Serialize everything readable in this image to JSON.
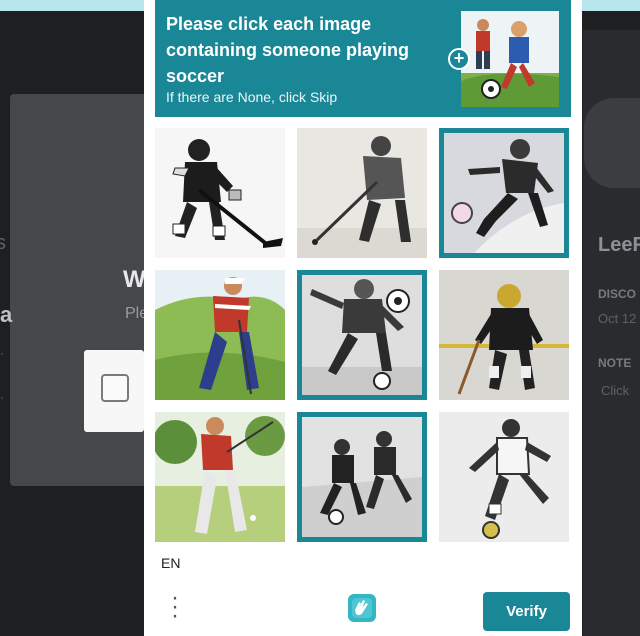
{
  "background": {
    "heading": "W",
    "subtext": "Ple",
    "left_letter": "a",
    "left_fragment": "s",
    "bottom_text": "...",
    "right_title": "LeeF",
    "right_label1": "DISCO",
    "right_value1": "Oct 12",
    "right_label2": "NOTE",
    "right_value2": "Click"
  },
  "captcha": {
    "prompt": "Please click each image containing someone playing soccer",
    "hint": "If there are None, click Skip",
    "example_icon": "soccer-player-example-image",
    "tiles": [
      {
        "subject": "hockey-player",
        "selected": false
      },
      {
        "subject": "hockey-player-stick",
        "selected": false
      },
      {
        "subject": "soccer-player-kicking",
        "selected": true
      },
      {
        "subject": "golfer",
        "selected": false
      },
      {
        "subject": "soccer-player-ball",
        "selected": true
      },
      {
        "subject": "hockey-player-helmet",
        "selected": false
      },
      {
        "subject": "golfer-swing",
        "selected": false
      },
      {
        "subject": "soccer-players-match",
        "selected": true
      },
      {
        "subject": "soccer-player-kick",
        "selected": false
      }
    ],
    "language": "EN",
    "verify_label": "Verify",
    "accent_color": "#1a8796"
  }
}
